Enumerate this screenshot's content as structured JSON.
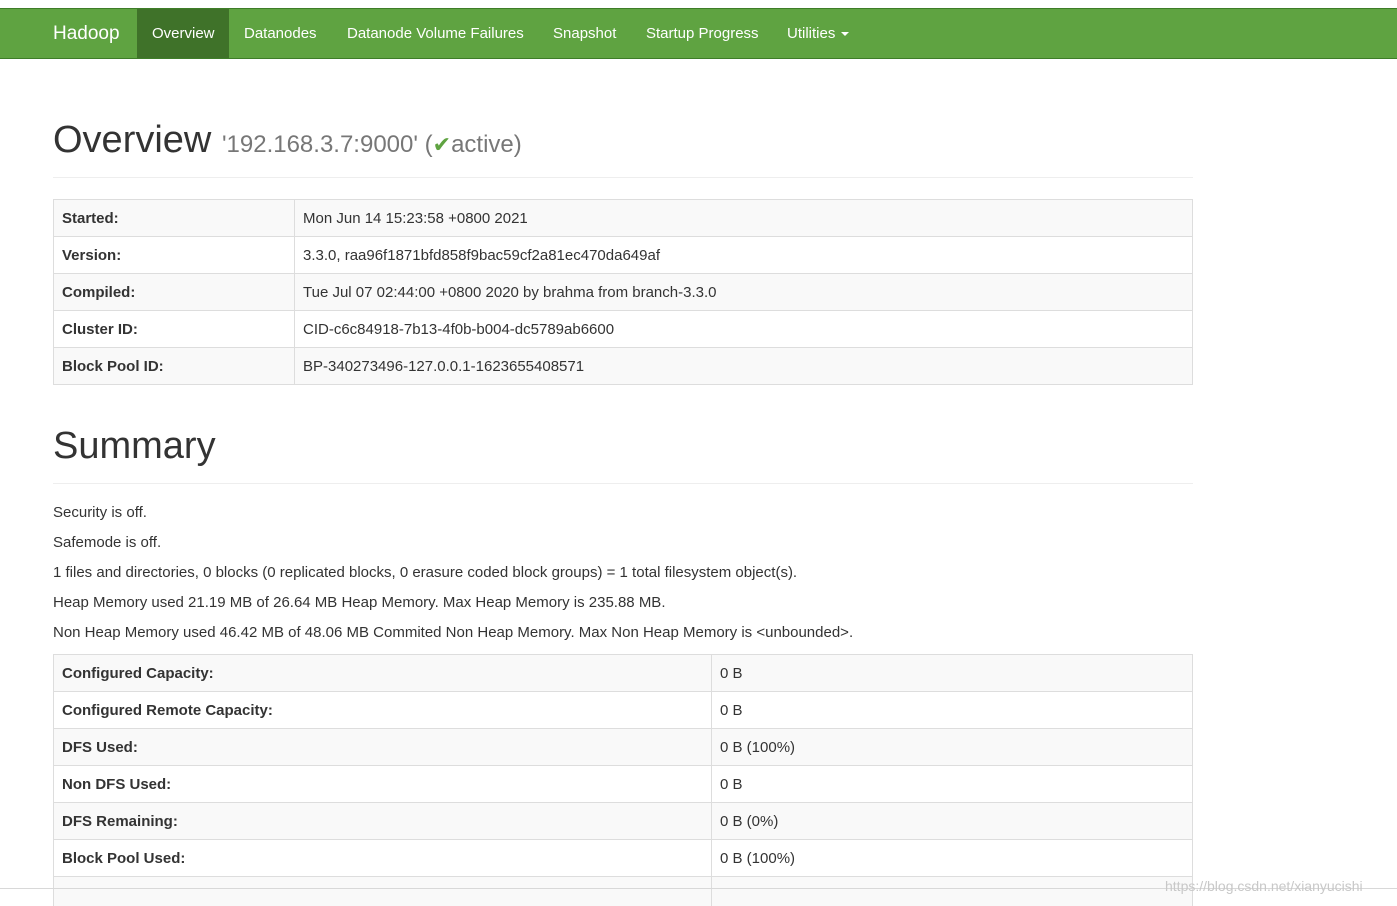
{
  "navbar": {
    "brand": "Hadoop",
    "items": [
      {
        "label": "Overview",
        "active": true
      },
      {
        "label": "Datanodes"
      },
      {
        "label": "Datanode Volume Failures"
      },
      {
        "label": "Snapshot"
      },
      {
        "label": "Startup Progress"
      },
      {
        "label": "Utilities"
      }
    ]
  },
  "overview": {
    "title": "Overview",
    "address": "'192.168.3.7:9000'",
    "state_open": "(",
    "state_check": "✔",
    "state": "active",
    "state_close": ")",
    "rows": [
      {
        "key": "Started:",
        "value": "Mon Jun 14 15:23:58 +0800 2021"
      },
      {
        "key": "Version:",
        "value": "3.3.0, raa96f1871bfd858f9bac59cf2a81ec470da649af"
      },
      {
        "key": "Compiled:",
        "value": "Tue Jul 07 02:44:00 +0800 2020 by brahma from branch-3.3.0"
      },
      {
        "key": "Cluster ID:",
        "value": "CID-c6c84918-7b13-4f0b-b004-dc5789ab6600"
      },
      {
        "key": "Block Pool ID:",
        "value": "BP-340273496-127.0.0.1-1623655408571"
      }
    ]
  },
  "summary": {
    "title": "Summary",
    "lines": [
      "Security is off.",
      "Safemode is off.",
      "1 files and directories, 0 blocks (0 replicated blocks, 0 erasure coded block groups) = 1 total filesystem object(s).",
      "Heap Memory used 21.19 MB of 26.64 MB Heap Memory. Max Heap Memory is 235.88 MB.",
      "Non Heap Memory used 46.42 MB of 48.06 MB Commited Non Heap Memory. Max Non Heap Memory is <unbounded>."
    ],
    "rows": [
      {
        "key": "Configured Capacity:",
        "value": "0 B"
      },
      {
        "key": "Configured Remote Capacity:",
        "value": "0 B"
      },
      {
        "key": "DFS Used:",
        "value": "0 B (100%)"
      },
      {
        "key": "Non DFS Used:",
        "value": "0 B"
      },
      {
        "key": "DFS Remaining:",
        "value": "0 B (0%)"
      },
      {
        "key": "Block Pool Used:",
        "value": "0 B (100%)"
      },
      {
        "key": "",
        "value": ""
      }
    ]
  },
  "watermark": "https://blog.csdn.net/xianyucishi"
}
